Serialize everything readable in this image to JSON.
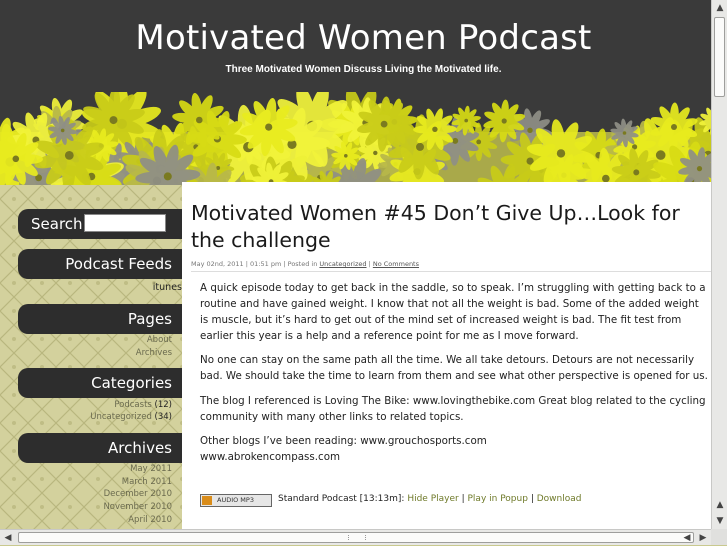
{
  "site": {
    "title": "Motivated Women Podcast",
    "tagline": "Three Motivated Women Discuss Living the Motivated life."
  },
  "sidebar": {
    "search_label": "Search",
    "podcast_feeds": {
      "heading": "Podcast Feeds",
      "items": [
        "itunes"
      ]
    },
    "pages": {
      "heading": "Pages",
      "items": [
        "About",
        "Archives"
      ]
    },
    "categories": {
      "heading": "Categories",
      "items": [
        {
          "name": "Podcasts",
          "count": "(12)"
        },
        {
          "name": "Uncategorized",
          "count": "(34)"
        }
      ]
    },
    "archives": {
      "heading": "Archives",
      "items": [
        "May 2011",
        "March 2011",
        "December 2010",
        "November 2010",
        "April 2010"
      ]
    }
  },
  "post": {
    "title": "Motivated Women #45 Don’t Give Up…Look for the challenge",
    "meta": {
      "date": "May 02nd, 2011",
      "time": "01:51 pm",
      "posted_in": "Posted in",
      "category": "Uncategorized",
      "comments": "No Comments"
    },
    "paragraphs": [
      "A quick episode today to get back in the saddle, so to speak. I’m struggling with getting back to a routine and have gained weight. I know that not all the weight is bad. Some of the added weight is muscle, but it’s hard to get out of the mind set of increased weight is bad. The fit test from earlier this year is a help and a reference point for me as I move forward.",
      "No one can stay on the same path all the time. We all take detours. Detours are not necessarily bad. We should take the time to learn from them and see what other perspective is opened for us.",
      "The blog I referenced is Loving The Bike: www.lovingthebike.com Great blog related to the cycling community with many other links to related topics.",
      "Other blogs I’ve been reading: www.grouchosports.com\nwww.abrokencompass.com"
    ],
    "player": {
      "badge": "AUDIO MP3",
      "label": "Standard Podcast [13:13m]:",
      "hide": "Hide Player",
      "play_popup": "Play in Popup",
      "download": "Download",
      "sep": "|"
    }
  },
  "colors": {
    "header_bg": "#3a3a3a",
    "flower_yellow": "#e8ec1c",
    "sidebar_bar": "#2d2d2d",
    "link_olive": "#6f7a2a"
  }
}
